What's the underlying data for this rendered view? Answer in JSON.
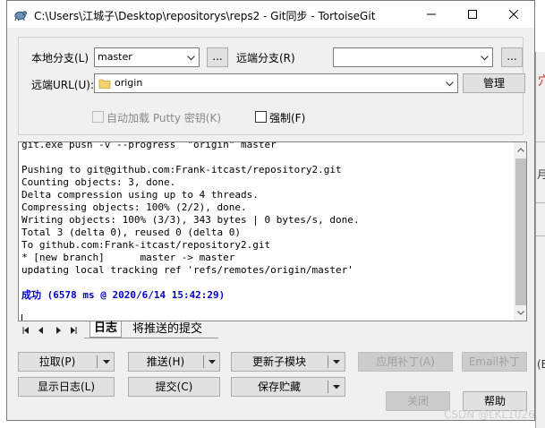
{
  "window": {
    "title": "C:\\Users\\江城子\\Desktop\\repositorys\\reps2 - Git同步 - TortoiseGit"
  },
  "form": {
    "local_branch_label": "本地分支(L)",
    "local_branch_value": "master",
    "local_branch_browse": "...",
    "remote_branch_label": "远端分支(R)",
    "remote_branch_value": "",
    "remote_branch_browse": "...",
    "remote_url_label": "远端URL(U):",
    "remote_url_value": "origin",
    "manage_label": "管理",
    "autoload_putty_label": "自动加载 Putty 密钥(K)",
    "autoload_putty_checked": false,
    "force_label": "强制(F)",
    "force_checked": false
  },
  "log": {
    "lines": [
      "git.exe push -v --progress  \"origin\" master",
      "",
      "Pushing to git@github.com:Frank-itcast/repository2.git",
      "Counting objects: 3, done.",
      "Delta compression using up to 4 threads.",
      "Compressing objects: 100% (2/2), done.",
      "Writing objects: 100% (3/3), 343 bytes | 0 bytes/s, done.",
      "Total 3 (delta 0), reused 0 (delta 0)",
      "To github.com:Frank-itcast/repository2.git",
      "* [new branch]      master -> master",
      "updating local tracking ref 'refs/remotes/origin/master'",
      "",
      ""
    ],
    "success_line": "成功 (6578 ms @ 2020/6/14 15:42:29)"
  },
  "tabs": [
    {
      "label": "日志",
      "active": true
    },
    {
      "label": "将推送的提交",
      "active": false
    }
  ],
  "buttons": {
    "pull": "拉取(P)",
    "push": "推送(H)",
    "update_submodule": "更新子模块",
    "apply_patch": "应用补丁(A)",
    "email_patch": "Email补丁",
    "show_log": "显示日志(L)",
    "commit": "提交(C)",
    "stash_save": "保存贮藏",
    "close": "关闭",
    "help": "帮助"
  },
  "watermark": "CSDN @LKL1026"
}
